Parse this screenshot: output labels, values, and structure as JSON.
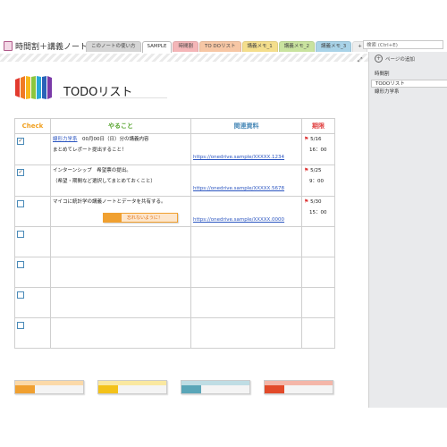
{
  "notebook": {
    "title": "時間割＋講義ノート"
  },
  "tabs": [
    {
      "label": "このノートの使い方",
      "color": "#d6d6d6"
    },
    {
      "label": "SAMPLE",
      "color": "#ffffff"
    },
    {
      "label": "時間割",
      "color": "#f4b6b8"
    },
    {
      "label": "TO DOリスト",
      "color": "#f7c7a5"
    },
    {
      "label": "講義メモ_1",
      "color": "#f4de8c"
    },
    {
      "label": "講義メモ_2",
      "color": "#c9e39f"
    },
    {
      "label": "講義メモ_3",
      "color": "#a9d3e8"
    },
    {
      "label": "+",
      "color": "#eeeeee"
    }
  ],
  "search": {
    "placeholder": "検索 (Ctrl+E)"
  },
  "sidebar": {
    "add_page": "ページの追加",
    "pages": [
      {
        "label": "時間割"
      },
      {
        "label": "TODOリスト"
      },
      {
        "label": "線形力学系"
      }
    ]
  },
  "page": {
    "title": "TODOリスト"
  },
  "table": {
    "headers": {
      "check": "Check",
      "todo": "やること",
      "docs": "関連資料",
      "due": "期限"
    },
    "rows": [
      {
        "checked": true,
        "link": "線形力学系",
        "line1_rest": "　00月00日（日）分の講義内容",
        "line2": "まとめてレポート提出すること！",
        "doc": "https://onedrive.sample/XXXXX.1234",
        "date": "5/16",
        "time": "16：00"
      },
      {
        "checked": true,
        "line1": "インターンシップ　希望票の提出。",
        "line2": "（希望・期間など選択してまとめておくこと）",
        "doc": "https://onedrive.sample/XXXXX.5678",
        "date": "5/25",
        "time": "9：00"
      },
      {
        "checked": false,
        "line1": "マイコに統計学の講義ノートとデータを共有する。",
        "sticky": "忘れないように！",
        "doc": "https://onedrive.sample/XXXXX.0000",
        "date": "5/30",
        "time": "15：00"
      }
    ]
  },
  "colors": {
    "orange": "#f0a030",
    "yellow": "#f3c21a",
    "teal": "#5aa6b8",
    "red": "#e24a2a"
  }
}
